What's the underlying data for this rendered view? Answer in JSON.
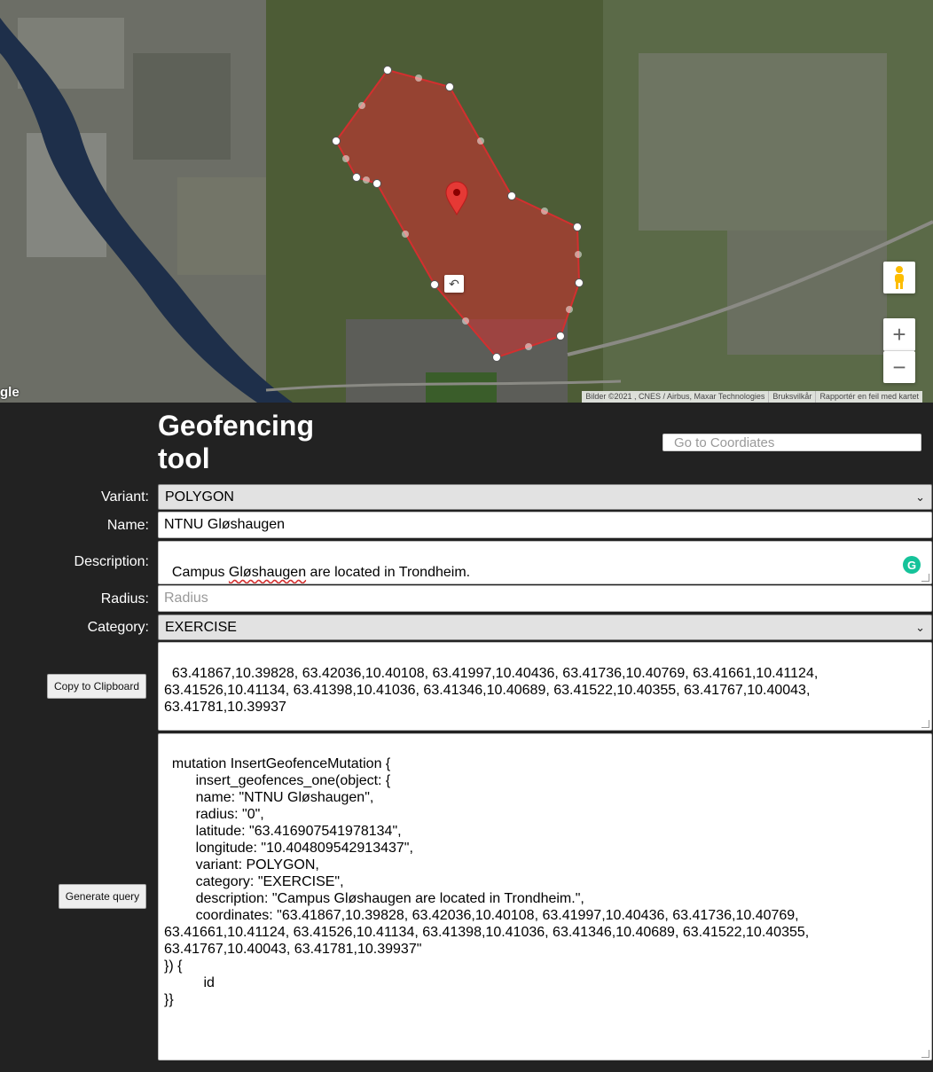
{
  "map": {
    "attribution": [
      "Bilder ©2021 , CNES / Airbus, Maxar Technologies",
      "Bruksvilkår",
      "Rapportér en feil med kartet"
    ],
    "google_logo": "gle",
    "zoom_in": "+",
    "zoom_out": "−",
    "undo": "↶",
    "polygon_color": "#d32f2f"
  },
  "header": {
    "title": "Geofencing tool",
    "coord_placeholder": "Go to Coordiates"
  },
  "form": {
    "variant_label": "Variant:",
    "variant_value": "POLYGON",
    "name_label": "Name:",
    "name_value": "NTNU Gløshaugen",
    "description_label": "Description:",
    "description_pre": "Campus ",
    "description_misspelled": "Gløshaugen",
    "description_post": " are located in Trondheim.",
    "radius_label": "Radius:",
    "radius_placeholder": "Radius",
    "category_label": "Category:",
    "category_value": "EXERCISE",
    "coordinates_text": "63.41867,10.39828, 63.42036,10.40108, 63.41997,10.40436, 63.41736,10.40769, 63.41661,10.41124,\n63.41526,10.41134, 63.41398,10.41036, 63.41346,10.40689, 63.41522,10.40355, 63.41767,10.40043,\n63.41781,10.39937",
    "copy_button": "Copy to Clipboard",
    "generate_button": "Generate query",
    "query_text": "mutation InsertGeofenceMutation {\n        insert_geofences_one(object: {\n        name: \"NTNU Gløshaugen\",\n        radius: \"0\",\n        latitude: \"63.416907541978134\",\n        longitude: \"10.404809542913437\",\n        variant: POLYGON,\n        category: \"EXERCISE\",\n        description: \"Campus Gløshaugen are located in Trondheim.\",\n        coordinates: \"63.41867,10.39828, 63.42036,10.40108, 63.41997,10.40436, 63.41736,10.40769,\n63.41661,10.41124, 63.41526,10.41134, 63.41398,10.41036, 63.41346,10.40689, 63.41522,10.40355,\n63.41767,10.40043, 63.41781,10.39937\"\n}) {\n          id\n}}"
  }
}
